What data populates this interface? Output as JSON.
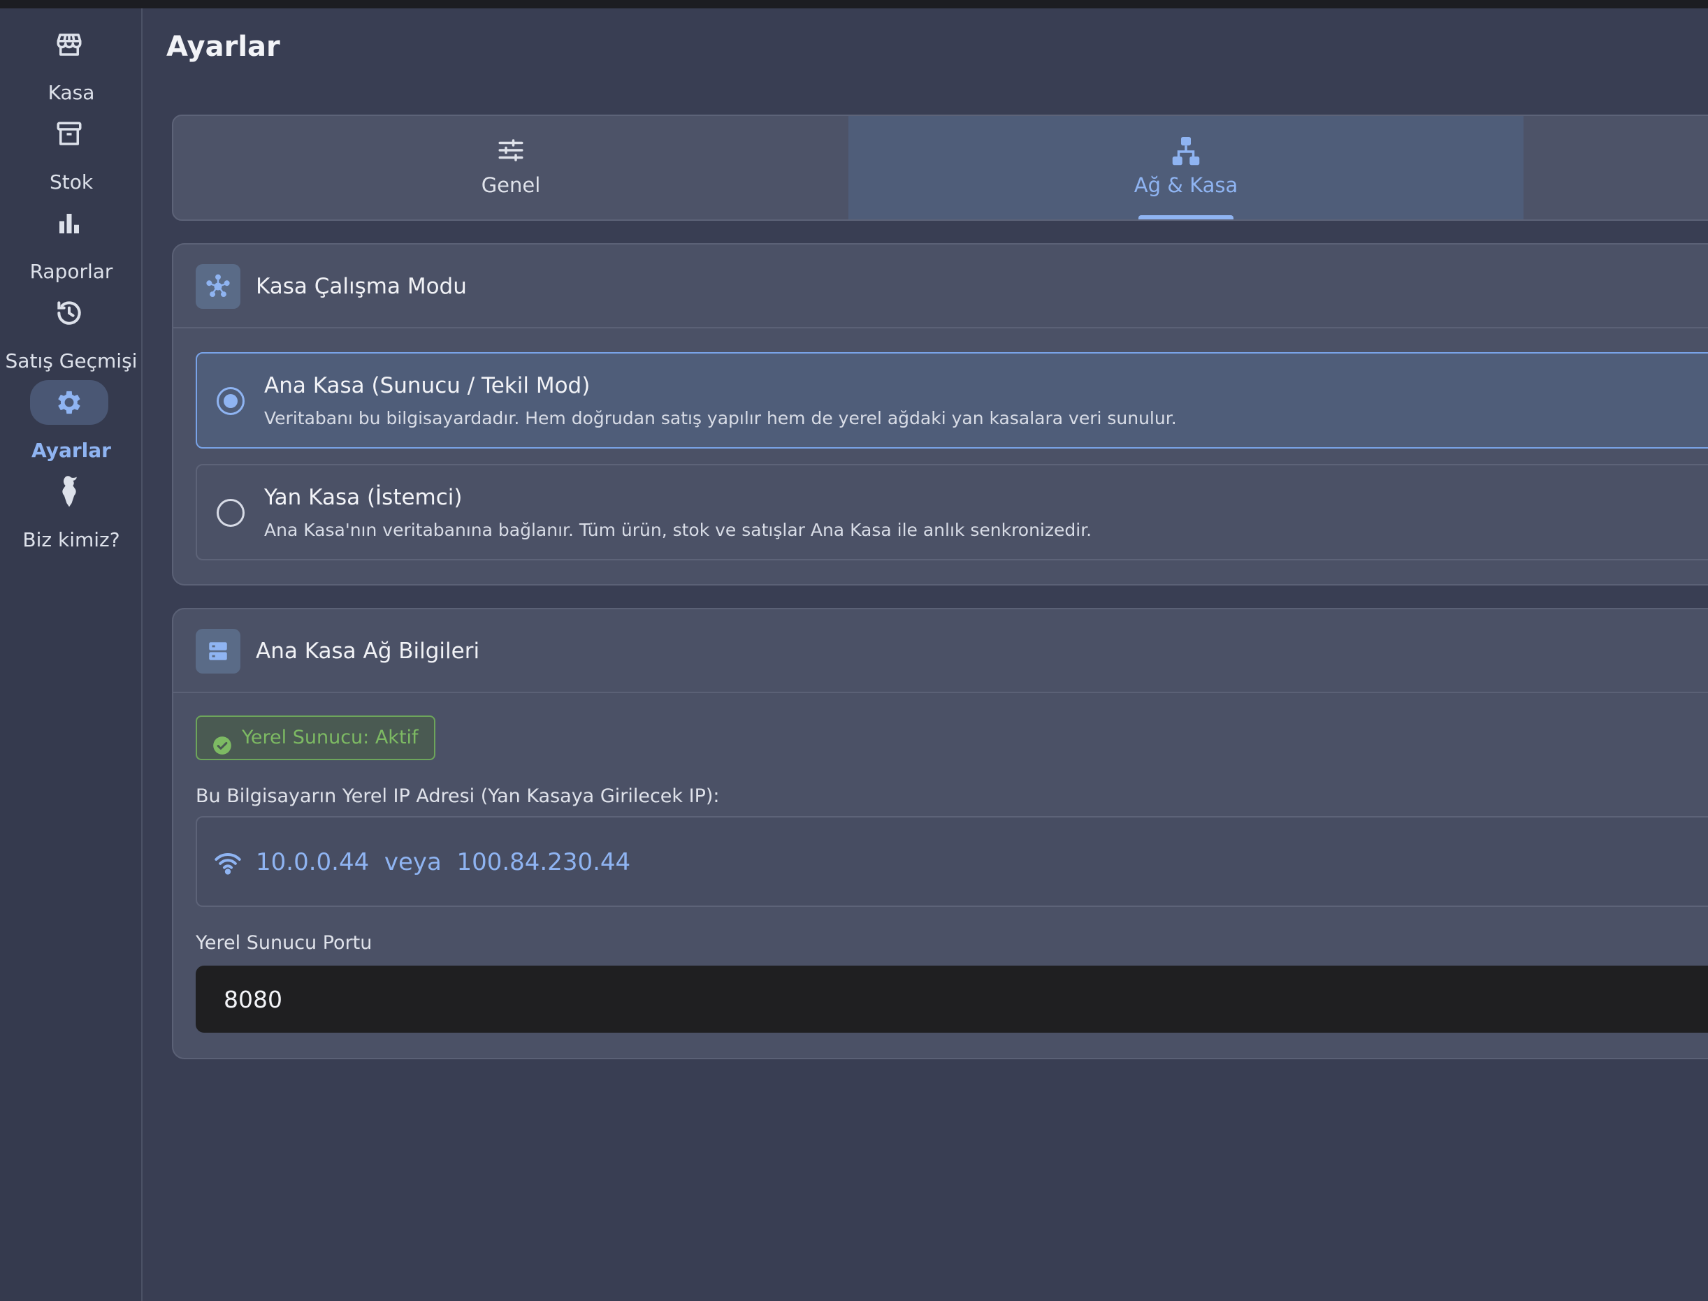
{
  "sidebar": {
    "items": [
      {
        "label": "Kasa",
        "icon": "store-icon"
      },
      {
        "label": "Stok",
        "icon": "archive-icon"
      },
      {
        "label": "Raporlar",
        "icon": "bar-chart-icon"
      },
      {
        "label": "Satış Geçmişi",
        "icon": "history-icon"
      },
      {
        "label": "Ayarlar",
        "icon": "gear-icon",
        "active": true
      },
      {
        "label": "Biz kimiz?",
        "icon": "goat-logo-icon"
      }
    ]
  },
  "page": {
    "title": "Ayarlar"
  },
  "tabs": [
    {
      "label": "Genel",
      "icon": "sliders-icon"
    },
    {
      "label": "Ağ & Kasa",
      "icon": "network-icon",
      "active": true
    }
  ],
  "mode_card": {
    "title": "Kasa Çalışma Modu",
    "icon": "hub-icon",
    "options": [
      {
        "title": "Ana Kasa (Sunucu / Tekil Mod)",
        "description": "Veritabanı bu bilgisayardadır. Hem doğrudan satış yapılır hem de yerel ağdaki yan kasalara veri sunulur.",
        "selected": true
      },
      {
        "title": "Yan Kasa (İstemci)",
        "description": "Ana Kasa'nın veritabanına bağlanır. Tüm ürün, stok ve satışlar Ana Kasa ile anlık senkronizedir.",
        "selected": false
      }
    ]
  },
  "network_card": {
    "title": "Ana Kasa Ağ Bilgileri",
    "icon": "server-icon",
    "status_badge": "Yerel Sunucu: Aktif",
    "ip_label": "Bu Bilgisayarın Yerel IP Adresi (Yan Kasaya Girilecek IP):",
    "ip_text": "10.0.0.44  veya  100.84.230.44",
    "port_label": "Yerel Sunucu Portu",
    "port_value": "8080"
  },
  "colors": {
    "accent": "#8fb4f2",
    "success": "#7dba63",
    "background": "#393e53",
    "card": "#4b5166"
  }
}
